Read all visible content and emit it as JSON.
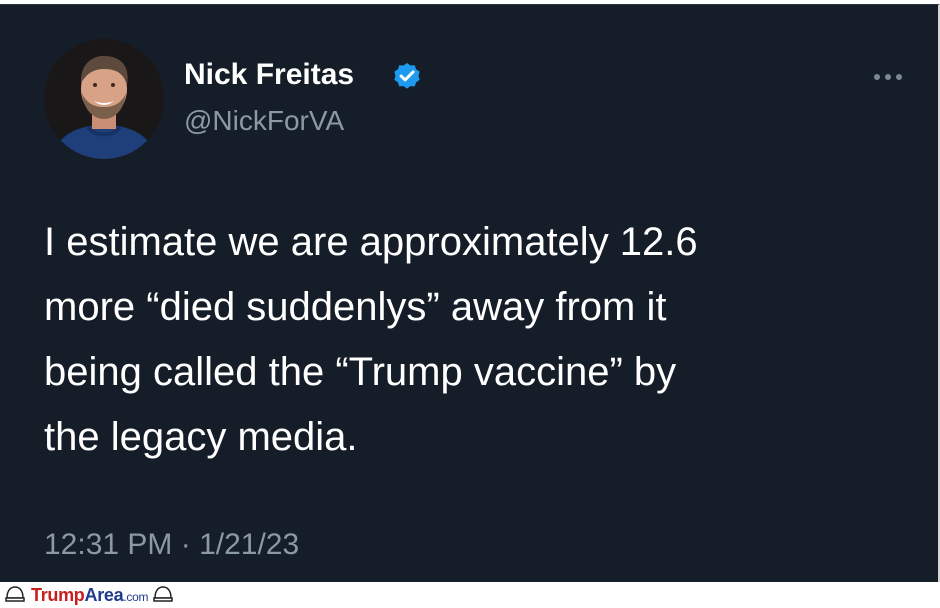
{
  "tweet": {
    "author_name": "Nick Freitas",
    "author_handle": "@NickForVA",
    "verified_badge_color": "#1d9bf0",
    "text_lines": [
      "I estimate we are approximately 12.6",
      "more “died suddenlys” away from it",
      "being called the “Trump vaccine” by",
      "the legacy media."
    ],
    "timestamp": "12:31 PM · 1/21/23",
    "more_icon": "more-horizontal-icon"
  },
  "theme": {
    "background": "#151d28",
    "primary_text": "#ffffff",
    "secondary_text": "#8b98a5"
  },
  "watermark": {
    "text_part1": "Trump",
    "text_part2": "Area",
    "text_part3": ".com"
  }
}
